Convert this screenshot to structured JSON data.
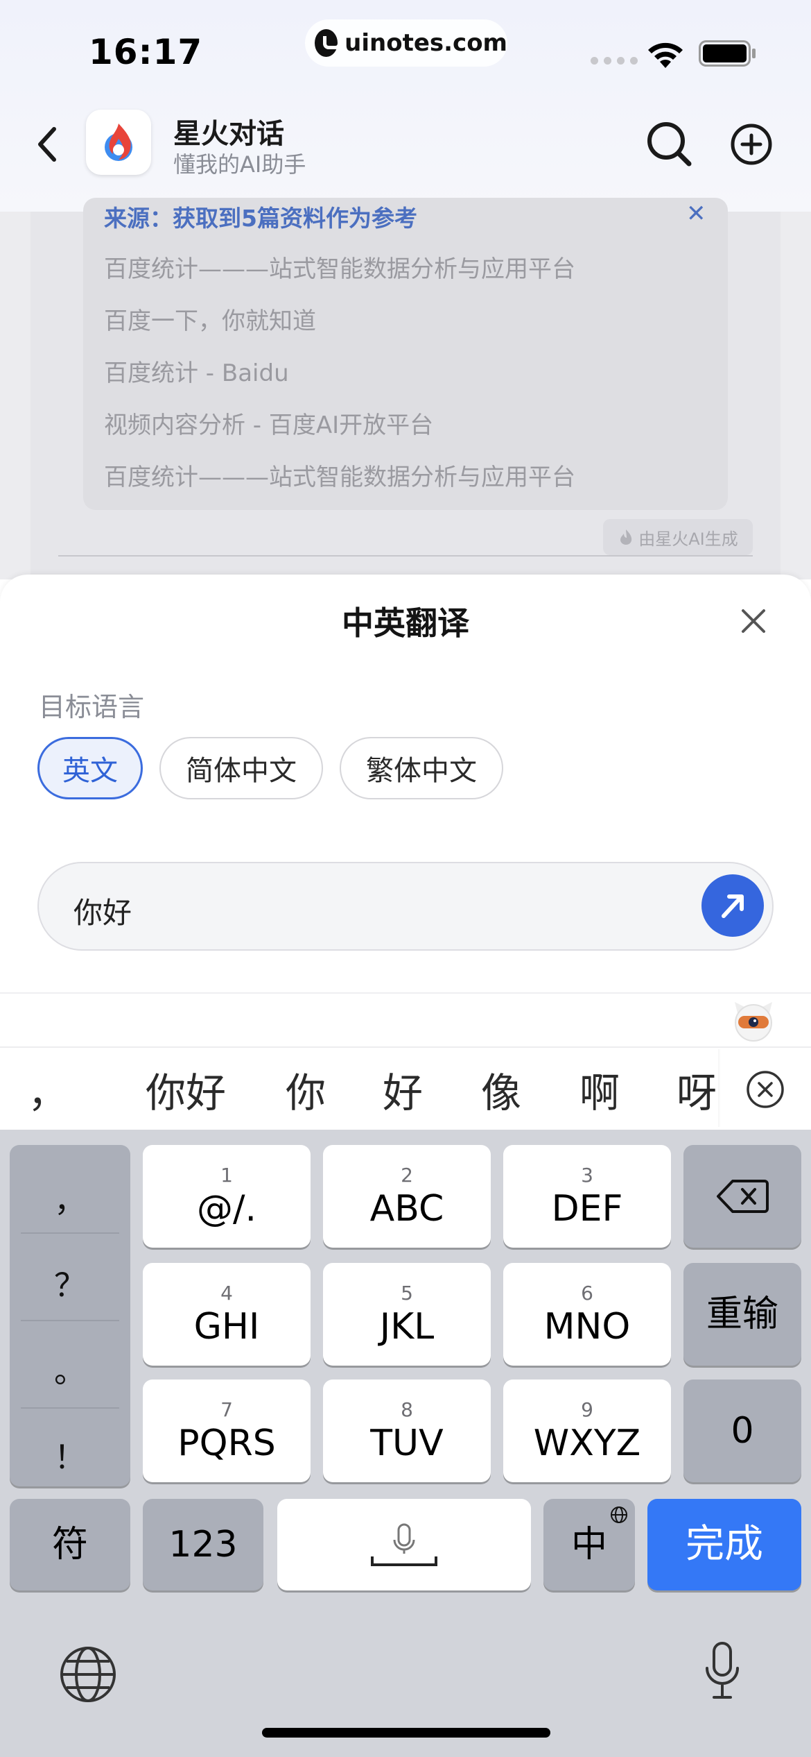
{
  "status_bar": {
    "time": "16:17",
    "url": "uinotes.com"
  },
  "header": {
    "title": "星火对话",
    "subtitle": "懂我的AI助手"
  },
  "chat": {
    "source_header": "来源：获取到5篇资料作为参考",
    "source_items": [
      "百度统计———站式智能数据分析与应用平台",
      "百度一下，你就知道",
      "百度统计 - Baidu",
      "视频内容分析 - 百度AI开放平台",
      "百度统计———站式智能数据分析与应用平台"
    ],
    "ai_badge": "由星火AI生成"
  },
  "sheet": {
    "title": "中英翻译",
    "target_label": "目标语言",
    "languages": [
      "英文",
      "简体中文",
      "繁体中文"
    ],
    "selected_language": "英文",
    "input_value": "你好"
  },
  "candidates": {
    "comma": "，",
    "items": [
      "你好",
      "你",
      "好",
      "像",
      "啊",
      "呀"
    ]
  },
  "keyboard": {
    "punctuation": [
      "，",
      "？",
      "。",
      "！"
    ],
    "keys": [
      {
        "num": "1",
        "label": "@/."
      },
      {
        "num": "2",
        "label": "ABC"
      },
      {
        "num": "3",
        "label": "DEF"
      },
      {
        "num": "4",
        "label": "GHI"
      },
      {
        "num": "5",
        "label": "JKL"
      },
      {
        "num": "6",
        "label": "MNO"
      },
      {
        "num": "7",
        "label": "PQRS"
      },
      {
        "num": "8",
        "label": "TUV"
      },
      {
        "num": "9",
        "label": "WXYZ"
      }
    ],
    "reinput": "重输",
    "zero": "0",
    "symbols": "符",
    "numbers": "123",
    "lang_switch": "中",
    "done": "完成"
  },
  "colors": {
    "accent": "#3566de",
    "done_key": "#3478f6",
    "keyboard_bg": "#d2d4da"
  }
}
